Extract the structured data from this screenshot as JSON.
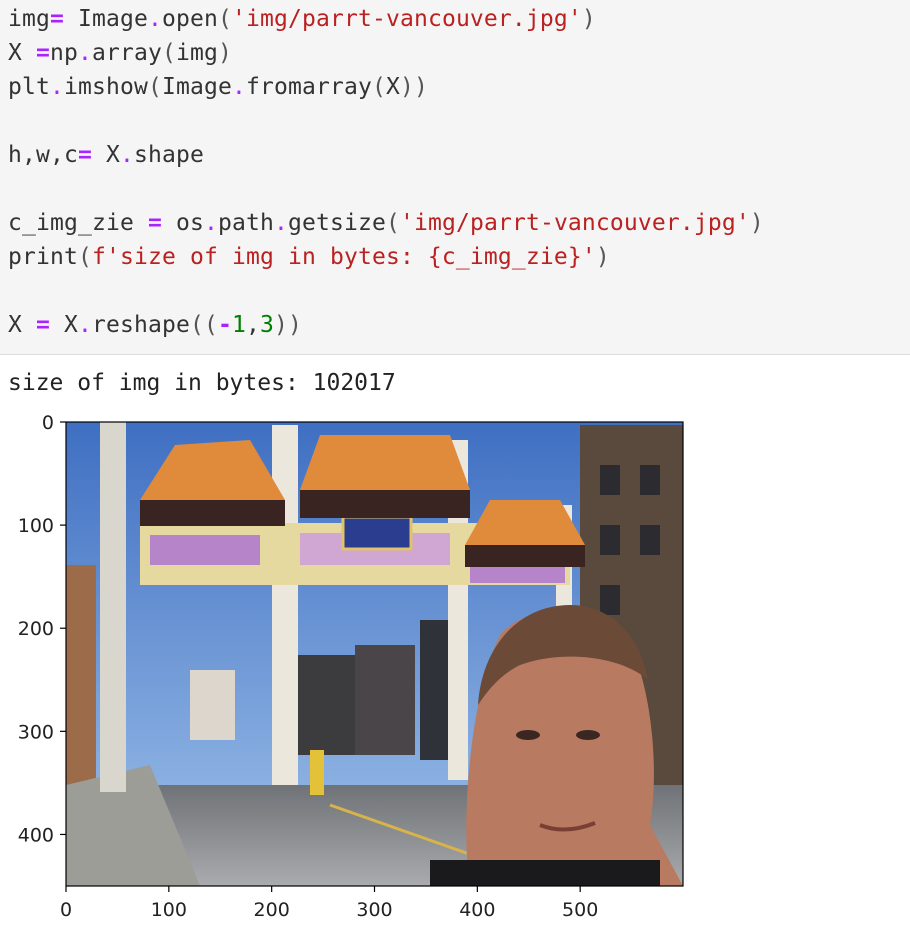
{
  "code_cell": {
    "lines": [
      [
        [
          "var",
          "img"
        ],
        [
          "op",
          "="
        ],
        [
          "plain",
          " Image"
        ],
        [
          "dot",
          "."
        ],
        [
          "plain",
          "open"
        ],
        [
          "par",
          "("
        ],
        [
          "str",
          "'img/parrt-vancouver.jpg'"
        ],
        [
          "par",
          ")"
        ]
      ],
      [
        [
          "var",
          "X "
        ],
        [
          "op",
          "="
        ],
        [
          "plain",
          "np"
        ],
        [
          "dot",
          "."
        ],
        [
          "plain",
          "array"
        ],
        [
          "par",
          "("
        ],
        [
          "plain",
          "img"
        ],
        [
          "par",
          ")"
        ]
      ],
      [
        [
          "var",
          "plt"
        ],
        [
          "dot",
          "."
        ],
        [
          "plain",
          "imshow"
        ],
        [
          "par",
          "("
        ],
        [
          "plain",
          "Image"
        ],
        [
          "dot",
          "."
        ],
        [
          "plain",
          "fromarray"
        ],
        [
          "par",
          "("
        ],
        [
          "plain",
          "X"
        ],
        [
          "par",
          "))"
        ]
      ],
      [],
      [
        [
          "var",
          "h,w,c"
        ],
        [
          "op",
          "="
        ],
        [
          "plain",
          " X"
        ],
        [
          "dot",
          "."
        ],
        [
          "plain",
          "shape"
        ]
      ],
      [],
      [
        [
          "var",
          "c_img_zie "
        ],
        [
          "op",
          "="
        ],
        [
          "plain",
          " os"
        ],
        [
          "dot",
          "."
        ],
        [
          "plain",
          "path"
        ],
        [
          "dot",
          "."
        ],
        [
          "plain",
          "getsize"
        ],
        [
          "par",
          "("
        ],
        [
          "str",
          "'img/parrt-vancouver.jpg'"
        ],
        [
          "par",
          ")"
        ]
      ],
      [
        [
          "plain",
          "print"
        ],
        [
          "par",
          "("
        ],
        [
          "str",
          "f'size of img in bytes: {c_img_zie}'"
        ],
        [
          "par",
          ")"
        ]
      ],
      [],
      [
        [
          "var",
          "X "
        ],
        [
          "op",
          "="
        ],
        [
          "plain",
          " X"
        ],
        [
          "dot",
          "."
        ],
        [
          "plain",
          "reshape"
        ],
        [
          "par",
          "(("
        ],
        [
          "op",
          "-"
        ],
        [
          "num",
          "1"
        ],
        [
          "plain",
          ","
        ],
        [
          "num",
          "3"
        ],
        [
          "par",
          "))"
        ]
      ]
    ]
  },
  "output": {
    "text": "size of img in bytes: 102017"
  },
  "plot": {
    "x_ticks": [
      "0",
      "100",
      "200",
      "300",
      "400",
      "500"
    ],
    "y_ticks": [
      "0",
      "100",
      "200",
      "300",
      "400"
    ],
    "x_tick_values": [
      0,
      100,
      200,
      300,
      400,
      500
    ],
    "y_tick_values": [
      0,
      100,
      200,
      300,
      400
    ],
    "x_range": [
      0,
      600
    ],
    "y_range": [
      0,
      450
    ],
    "image_subject": "photo-of-chinatown-gate-with-selfie",
    "colors": {
      "sky": "#5f8fd6",
      "roof": "#e08a3c",
      "pillar": "#ece7dc",
      "road": "#8c8f93",
      "skin": "#b97a62"
    }
  }
}
